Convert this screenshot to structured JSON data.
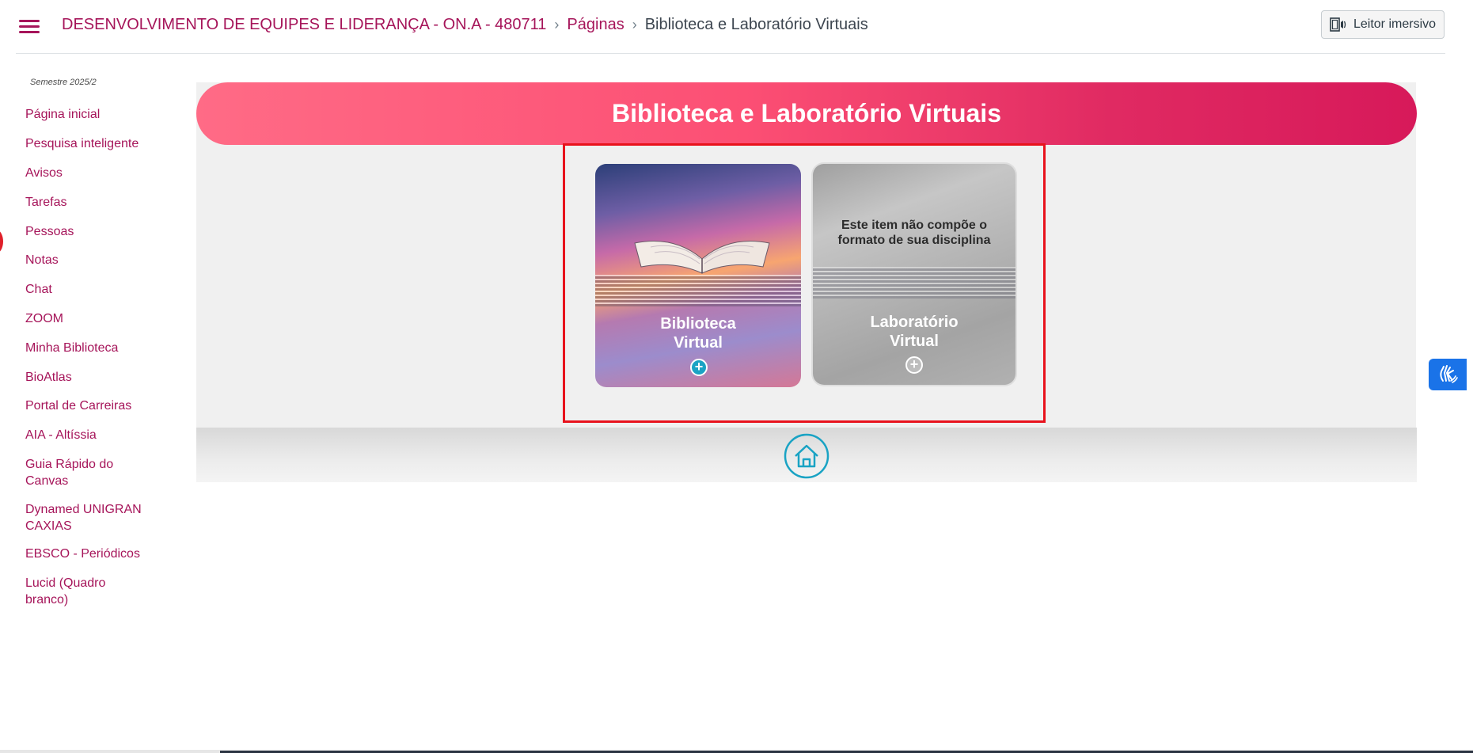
{
  "header": {
    "course_title": "DESENVOLVIMENTO DE EQUIPES E LIDERANÇA - ON.A - 480711",
    "breadcrumb_pages": "Páginas",
    "breadcrumb_current": "Biblioteca e Laboratório Virtuais",
    "immersive_reader_label": "Leitor imersivo"
  },
  "sidebar": {
    "semester": "Semestre 2025/2",
    "items": [
      {
        "label": "Página inicial"
      },
      {
        "label": "Pesquisa inteligente"
      },
      {
        "label": "Avisos"
      },
      {
        "label": "Tarefas"
      },
      {
        "label": "Pessoas"
      },
      {
        "label": "Notas"
      },
      {
        "label": "Chat"
      },
      {
        "label": "ZOOM"
      },
      {
        "label": "Minha Biblioteca"
      },
      {
        "label": "BioAtlas"
      },
      {
        "label": "Portal de Carreiras"
      },
      {
        "label": "AIA - Altíssia"
      },
      {
        "label": "Guia Rápido do Canvas"
      },
      {
        "label": "Dynamed UNIGRAN CAXIAS"
      },
      {
        "label": "EBSCO - Periódicos"
      },
      {
        "label": "Lucid (Quadro branco)"
      }
    ]
  },
  "main": {
    "banner_title": "Biblioteca e Laboratório Virtuais",
    "cards": {
      "library": {
        "title_line1": "Biblioteca",
        "title_line2": "Virtual",
        "icon": "plus-circle-icon"
      },
      "lab": {
        "note_line1": "Este item não compõe o",
        "note_line2": "formato de sua disciplina",
        "title_line1": "Laboratório",
        "title_line2": "Virtual",
        "icon": "plus-circle-icon"
      }
    },
    "home_icon": "home-icon"
  },
  "accessibility": {
    "sign_language_icon": "sign-language-icon"
  },
  "colors": {
    "brand": "#a6155a",
    "banner_start": "#ff6b86",
    "banner_end": "#d7195a",
    "highlight_border": "#e8121c",
    "home_icon": "#1aa3c4",
    "libras_button": "#1a73e8"
  }
}
